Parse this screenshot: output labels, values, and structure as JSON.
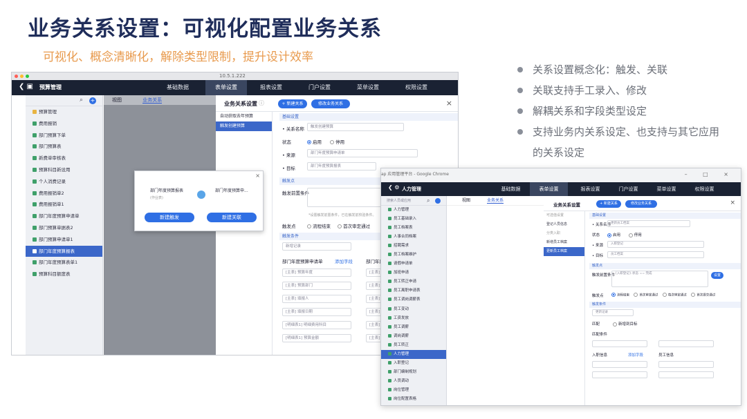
{
  "slide": {
    "title": "业务关系设置：可视化配置业务关系",
    "subtitle": "可视化、概念清晰化，解除类型限制，提升设计效率",
    "bullets": [
      "关系设置概念化：触发、关联",
      "关联支持手工录入、修改",
      "解耦关系和字段类型设定",
      "支持业务内关系设定、也支持与其它应用的关系设定"
    ]
  },
  "colors": {
    "nav": "#1a2233",
    "accent": "#2f6fe4",
    "title": "#1f2d5a",
    "subtitle": "#e89a4d"
  },
  "window1": {
    "url": "10.5.1.222",
    "app_name": "预算管理",
    "tabs": [
      "基础数据",
      "表单设置",
      "报表设置",
      "门户设置",
      "菜单设置",
      "权限设置"
    ],
    "active_tab": 1,
    "tree": [
      {
        "label": "预算管理",
        "folder": true
      },
      {
        "label": "费用报销",
        "folder": false
      },
      {
        "label": "部门预算下单",
        "folder": false
      },
      {
        "label": "部门预算表",
        "folder": false
      },
      {
        "label": "新费单审核表",
        "folder": false
      },
      {
        "label": "预算科目新设用",
        "folder": false
      },
      {
        "label": "个人消费记录",
        "folder": false
      },
      {
        "label": "费用报销单2",
        "folder": false
      },
      {
        "label": "费用报销单1",
        "folder": false
      },
      {
        "label": "部门年度预算申请单",
        "folder": false
      },
      {
        "label": "部门预算单据表2",
        "folder": false
      },
      {
        "label": "部门预算申请单1",
        "folder": false
      },
      {
        "label": "部门年度预算报表",
        "folder": false,
        "selected": true
      },
      {
        "label": "部门年度预算表单1",
        "folder": false
      },
      {
        "label": "预算科目额度表",
        "folder": false
      }
    ],
    "view_tabs": [
      "视图",
      "业务关系"
    ],
    "panel": {
      "title": "业务关系设置",
      "btn_new": "+ 新建关系",
      "btn_edit": "修改业务关系",
      "close": "×",
      "list": [
        "自动获取去年预算",
        "触发创建预算"
      ],
      "selected_list": 1,
      "section_basic": "基础设置",
      "fields": {
        "name_label": "• 关系名称",
        "name_value": "触发创建预算",
        "status_label": "状态",
        "status_on": "启用",
        "status_off": "停用",
        "source_label": "• 来源",
        "source_value": "部门年度预算申请单",
        "target_label": "• 目标",
        "target_value": "部门年度预算报表"
      },
      "section_trigger": "触发点",
      "trigger_cond_label": "触发前置条件",
      "trigger_hint": "*设置触发前置条件，已在触发前校验条件。",
      "trigger_point_label": "触发点",
      "trigger_point_a": "流程结束",
      "trigger_point_b": "首次审定通过",
      "section_cond": "触发条件",
      "cond_select": "新增记录",
      "col_left": "部门年度预算申请单",
      "col_right": "部门年度",
      "add_field": "添加字段",
      "cond_rows": [
        "[主表] 预算年度",
        "[主表] 预算部门",
        "[主表] 填报人",
        "[主表] 填报日期",
        "[明细表1] 明细费用科目",
        "[明细表1] 预算金额"
      ],
      "cond_rows_right": [
        "[主表]",
        "[主表]",
        "[主表]",
        "[主表]",
        "[主表]",
        "[主表]"
      ]
    },
    "dialog": {
      "left_title": "部门年度预算报表",
      "left_sub": "(作业表)",
      "right_title": "部门年度预算申...",
      "btn_trigger": "新建触发",
      "btn_link": "新建关联"
    }
  },
  "window2": {
    "chrome_title": "ap 应用管理平台 - Google Chrome",
    "app_name": "人力管理",
    "tabs": [
      "基础数据",
      "表单设置",
      "报表设置",
      "门户设置",
      "菜单设置",
      "权限设置"
    ],
    "active_tab": 1,
    "search_placeholder": "搜索人员或应用",
    "tree": [
      "人力管理",
      "员工基础录入",
      "员工档案表",
      "人事合同档案",
      "招聘需求",
      "员工档案维护",
      "请假申请单",
      "加班申请",
      "员工转正申请",
      "员工离职申请表",
      "员工调岗调薪表",
      "员工变动",
      "工资发放",
      "员工调薪",
      "调岗调薪",
      "员工转正",
      "人力管理",
      "入职登记",
      "部门编制规划",
      "人员调动",
      "岗位管理",
      "岗位配置表格",
      "岗位调整"
    ],
    "selected_tree": 16,
    "view_tabs": [
      "视图",
      "业务关系"
    ],
    "panel": {
      "title": "业务关系设置",
      "btn_new": "+ 新建关系",
      "btn_edit": "修改业务关系",
      "list": [
        "可选值设置",
        "登记人员信息",
        "分类入职",
        "新增员工档案",
        "更新员工档案"
      ],
      "selected_list": 4,
      "section_basic": "基础设置",
      "name_label": "• 关系名称",
      "name_value": "更新员工档案",
      "status_label": "状态",
      "status_on": "启用",
      "status_off": "停用",
      "source_label": "• 来源",
      "source_value": "入职登记",
      "target_label": "• 目标",
      "target_value": "员工档案",
      "section_trigger": "触发点",
      "trigger_cond_label": "触发前置条件",
      "trigger_expr": "{入职登记}.状态 == 完成",
      "trigger_btn": "设置",
      "trigger_point_label": "触发点",
      "trigger_points": [
        "流程结束",
        "首次审定通过",
        "每次审定通过",
        "首次提交通过"
      ],
      "section_cond": "触发条件",
      "cond_select": "更新记录",
      "match_label": "匹配",
      "match_opt": "新增到目标",
      "sub_label": "匹配条件",
      "col_left": "入职信息",
      "col_right": "员工信息",
      "add_field": "添加字段"
    }
  }
}
